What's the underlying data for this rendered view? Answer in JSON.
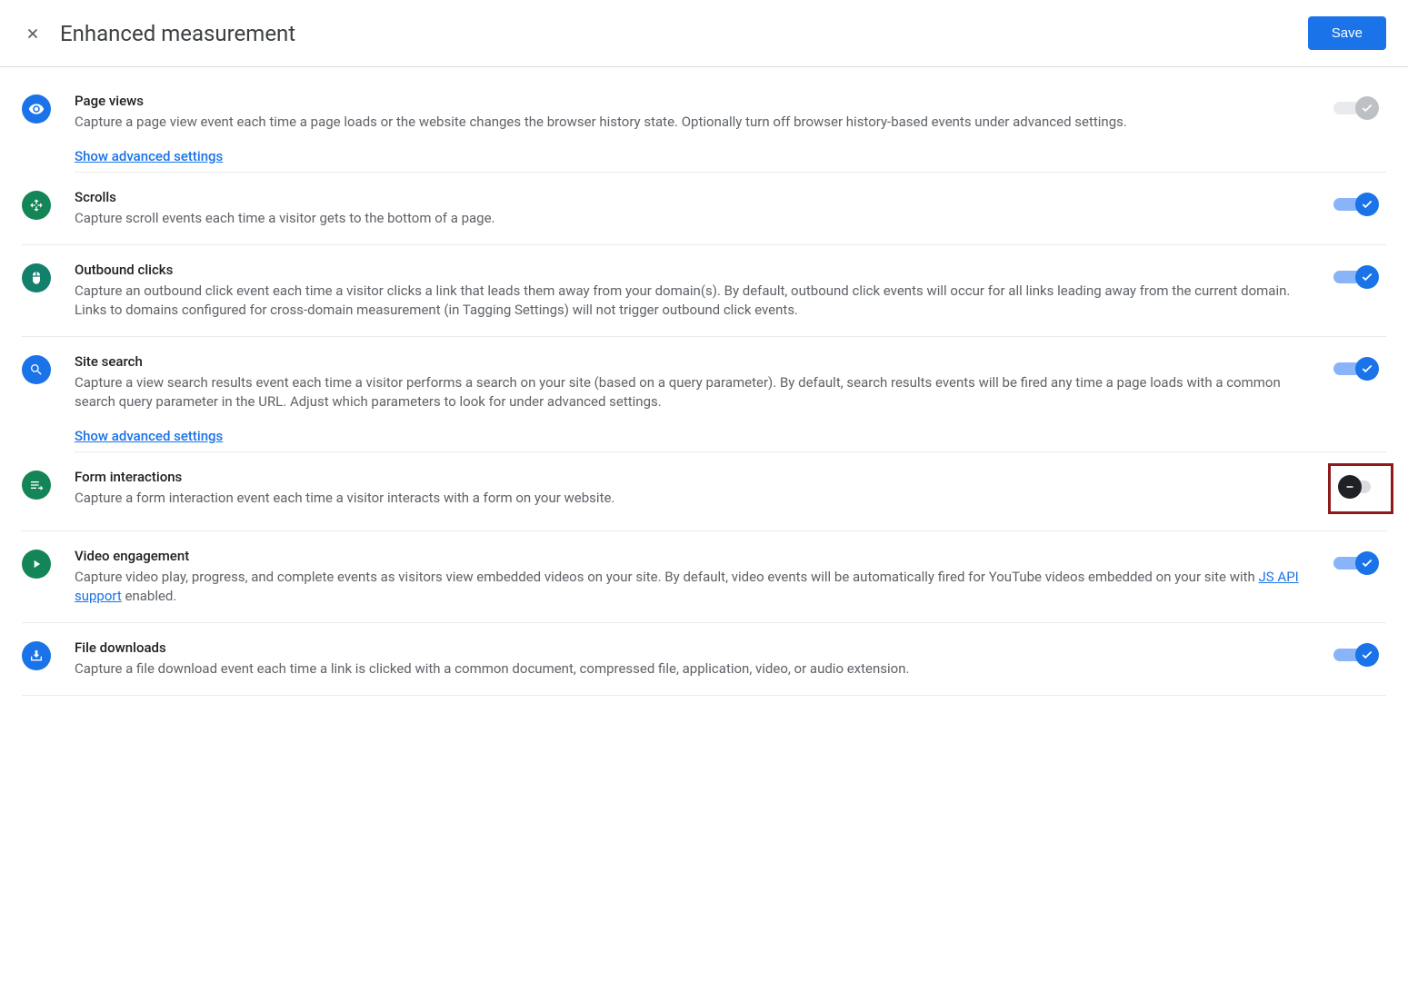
{
  "header": {
    "title": "Enhanced measurement",
    "save_label": "Save"
  },
  "advanced_link": "Show advanced settings",
  "items": {
    "page_views": {
      "title": "Page views",
      "desc": "Capture a page view event each time a page loads or the website changes the browser history state. Optionally turn off browser history-based events under advanced settings."
    },
    "scrolls": {
      "title": "Scrolls",
      "desc": "Capture scroll events each time a visitor gets to the bottom of a page."
    },
    "outbound": {
      "title": "Outbound clicks",
      "desc": "Capture an outbound click event each time a visitor clicks a link that leads them away from your domain(s). By default, outbound click events will occur for all links leading away from the current domain. Links to domains configured for cross-domain measurement (in Tagging Settings) will not trigger outbound click events."
    },
    "site_search": {
      "title": "Site search",
      "desc": "Capture a view search results event each time a visitor performs a search on your site (based on a query parameter). By default, search results events will be fired any time a page loads with a common search query parameter in the URL. Adjust which parameters to look for under advanced settings."
    },
    "form": {
      "title": "Form interactions",
      "desc": "Capture a form interaction event each time a visitor interacts with a form on your website."
    },
    "video": {
      "title": "Video engagement",
      "desc_prefix": "Capture video play, progress, and complete events as visitors view embedded videos on your site. By default, video events will be automatically fired for YouTube videos embedded on your site with ",
      "link_text": "JS API support",
      "desc_suffix": " enabled."
    },
    "downloads": {
      "title": "File downloads",
      "desc": "Capture a file download event each time a link is clicked with a common document, compressed file, application, video, or audio extension."
    }
  }
}
